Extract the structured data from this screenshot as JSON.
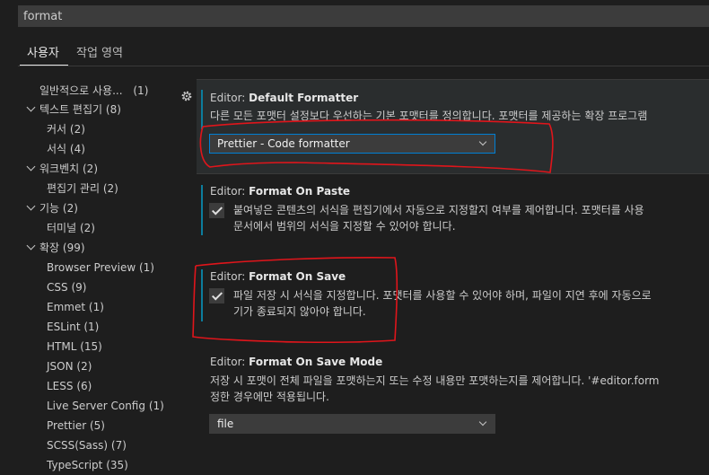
{
  "search": {
    "value": "format"
  },
  "tabs": [
    {
      "label": "사용자"
    },
    {
      "label": "작업 영역"
    }
  ],
  "tree": [
    {
      "label": "일반적으로 사용...",
      "count": "(1)"
    },
    {
      "label": "텍스트 편집기",
      "count": "(8)"
    },
    {
      "label": "커서",
      "count": "(2)"
    },
    {
      "label": "서식",
      "count": "(4)"
    },
    {
      "label": "워크벤치",
      "count": "(2)"
    },
    {
      "label": "편집기 관리",
      "count": "(2)"
    },
    {
      "label": "기능",
      "count": "(2)"
    },
    {
      "label": "터미널",
      "count": "(2)"
    },
    {
      "label": "확장",
      "count": "(99)"
    },
    {
      "label": "Browser Preview",
      "count": "(1)"
    },
    {
      "label": "CSS",
      "count": "(9)"
    },
    {
      "label": "Emmet",
      "count": "(1)"
    },
    {
      "label": "ESLint",
      "count": "(1)"
    },
    {
      "label": "HTML",
      "count": "(15)"
    },
    {
      "label": "JSON",
      "count": "(2)"
    },
    {
      "label": "LESS",
      "count": "(6)"
    },
    {
      "label": "Live Server Config",
      "count": "(1)"
    },
    {
      "label": "Prettier",
      "count": "(5)"
    },
    {
      "label": "SCSS(Sass)",
      "count": "(7)"
    },
    {
      "label": "TypeScript",
      "count": "(35)"
    }
  ],
  "settings": {
    "default_formatter": {
      "prefix": "Editor: ",
      "name": "Default Formatter",
      "description": "다른 모든 포맷터 설정보다 우선하는 기본 포맷터를 정의합니다. 포맷터를 제공하는 확장 프로그램",
      "value": "Prettier - Code formatter"
    },
    "format_on_paste": {
      "prefix": "Editor: ",
      "name": "Format On Paste",
      "description_line1": "붙여넣은 콘텐츠의 서식을 편집기에서 자동으로 지정할지 여부를 제어합니다. 포맷터를 사용",
      "description_line2": "문서에서 범위의 서식을 지정할 수 있어야 합니다.",
      "checked": true
    },
    "format_on_save": {
      "prefix": "Editor: ",
      "name": "Format On Save",
      "description_line1": "파일 저장 시 서식을 지정합니다. 포맷터를 사용할 수 있어야 하며, 파일이 지연 후에 자동으로",
      "description_line2": "기가 종료되지 않아야 합니다.",
      "checked": true
    },
    "format_on_save_mode": {
      "prefix": "Editor: ",
      "name": "Format On Save Mode",
      "description_line1": "저장 시 포맷이 전체 파일을 포맷하는지 또는 수정 내용만 포맷하는지를 제어합니다. '#editor.form",
      "description_line2": "정한 경우에만 적용됩니다.",
      "value": "file"
    }
  },
  "colors": {
    "annotation": "#e0151b",
    "focus": "#007fd4",
    "accent": "#0c7d9d"
  }
}
